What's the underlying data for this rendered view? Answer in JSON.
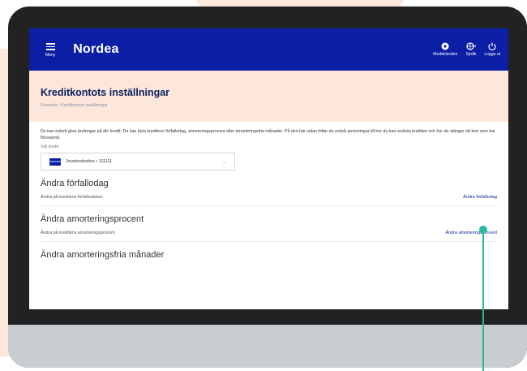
{
  "topbar": {
    "menu_label": "Meny",
    "logo": "Nordea",
    "items": [
      {
        "label": "Meddelanden",
        "icon": "message-icon"
      },
      {
        "label": "Språk",
        "icon": "globe-icon"
      },
      {
        "label": "Logga ut",
        "icon": "power-icon"
      }
    ]
  },
  "page": {
    "title": "Kreditkontots inställningar",
    "breadcrumb": "Framsida  ›  Kreditkontots inställningar"
  },
  "intro": "Du kan enkelt göra ändringar på din kredit. Du kan byta kreditens förfallodag, amorteringsprocent eller amorteringsfria månader. På den här sidan hittar du också anvisningar till hur du kan avsluta krediten och hur du stänger ett kort som har försvunnit.",
  "credit_select": {
    "label": "Välj kredit",
    "value": "Joustorahoitus • 111111"
  },
  "sections": [
    {
      "title": "Ändra förfallodag",
      "description": "Ändra på kreditens förfallodatum",
      "link": "Ändra förfallodag"
    },
    {
      "title": "Ändra amorteringsprocent",
      "description": "Ändra på kreditens amorteringsprocent",
      "link": "Ändra amorteringsprocent"
    },
    {
      "title": "Ändra amorteringsfria månader"
    }
  ],
  "colors": {
    "brand_blue": "#0b1ea5",
    "hero_bg": "#fde7dc",
    "pointer": "#2bb89a"
  }
}
